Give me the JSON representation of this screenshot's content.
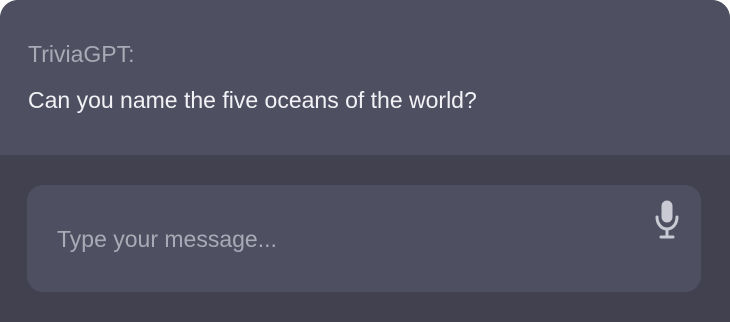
{
  "chat": {
    "sender_label": "TriviaGPT:",
    "message": "Can you name the five oceans of the world?"
  },
  "composer": {
    "input_value": "",
    "placeholder": "Type your message...",
    "mic_icon": "microphone-icon"
  },
  "colors": {
    "message_panel_bg": "#4e4f60",
    "composer_bg": "#41414f",
    "input_bg": "#4e4f60",
    "primary_text": "#f2f2f6",
    "muted_text": "#a9aab6",
    "icon": "#c9cad3"
  }
}
